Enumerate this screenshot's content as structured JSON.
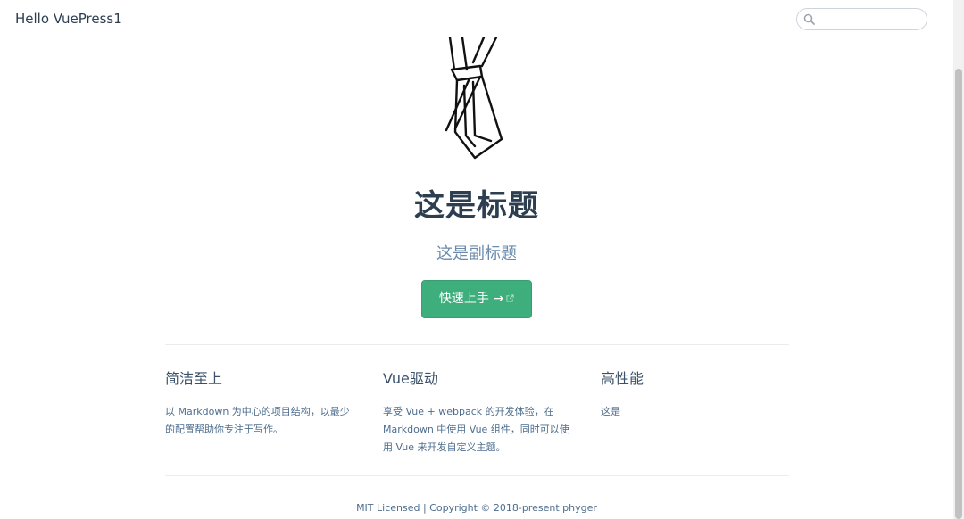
{
  "navbar": {
    "site_name": "Hello VuePress1",
    "search_placeholder": "",
    "search_icon": "magnifier-icon"
  },
  "hero": {
    "image": "tie-logo",
    "title": "这是标题",
    "description": "这是副标题",
    "action_label": "快速上手 →",
    "action_icon": "external-link-icon",
    "accent_color": "#3eaf7c"
  },
  "features": [
    {
      "title": "简洁至上",
      "details": "以 Markdown 为中心的项目结构，以最少的配置帮助你专注于写作。"
    },
    {
      "title": "Vue驱动",
      "details": "享受 Vue + webpack 的开发体验，在 Markdown 中使用 Vue 组件，同时可以使用 Vue 来开发自定义主题。"
    },
    {
      "title": "高性能",
      "details": "这是"
    }
  ],
  "footer": "MIT Licensed | Copyright © 2018-present phyger"
}
